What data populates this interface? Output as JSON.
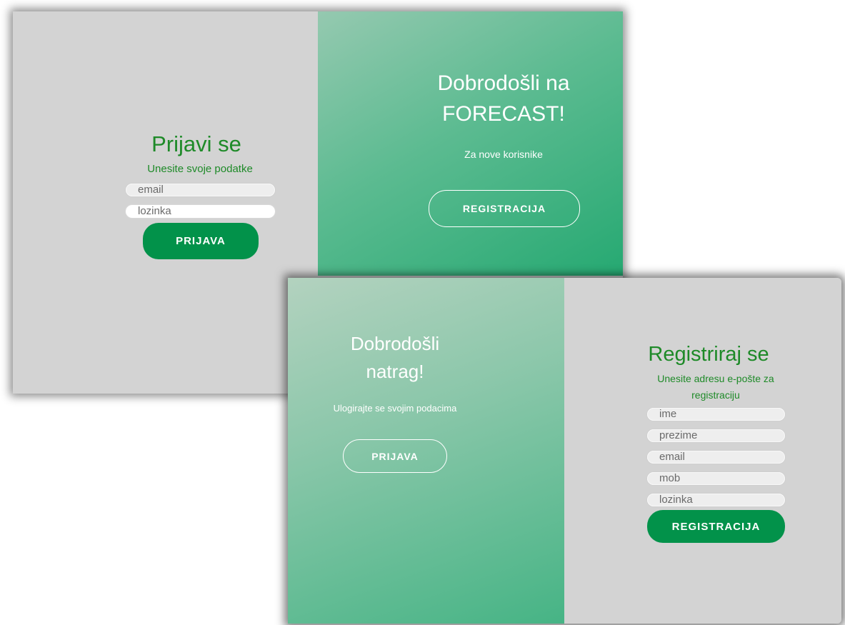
{
  "login_card": {
    "form": {
      "title": "Prijavi se",
      "subtitle": "Unesite svoje podatke",
      "email_placeholder": "email",
      "password_placeholder": "lozinka",
      "submit_label": "PRIJAVA"
    },
    "welcome": {
      "title": "Dobrodošli na FORECAST!",
      "subtitle": "Za nove korisnike",
      "button_label": "REGISTRACIJA"
    }
  },
  "register_card": {
    "welcome_back": {
      "title": "Dobrodošli natrag!",
      "subtitle": "Ulogirajte se svojim podacima",
      "button_label": "PRIJAVA"
    },
    "form": {
      "title": "Registriraj se",
      "subtitle": "Unesite adresu e-pošte za registraciju",
      "first_name_placeholder": "ime",
      "last_name_placeholder": "prezime",
      "email_placeholder": "email",
      "phone_placeholder": "mob",
      "password_placeholder": "lozinka",
      "submit_label": "REGISTRACIJA"
    }
  },
  "colors": {
    "brand_green": "#02924a",
    "heading_green": "#1e8a28",
    "panel_grey": "#d3d3d3",
    "gradient_start": "#95c9b0",
    "gradient_end": "#26a972"
  }
}
